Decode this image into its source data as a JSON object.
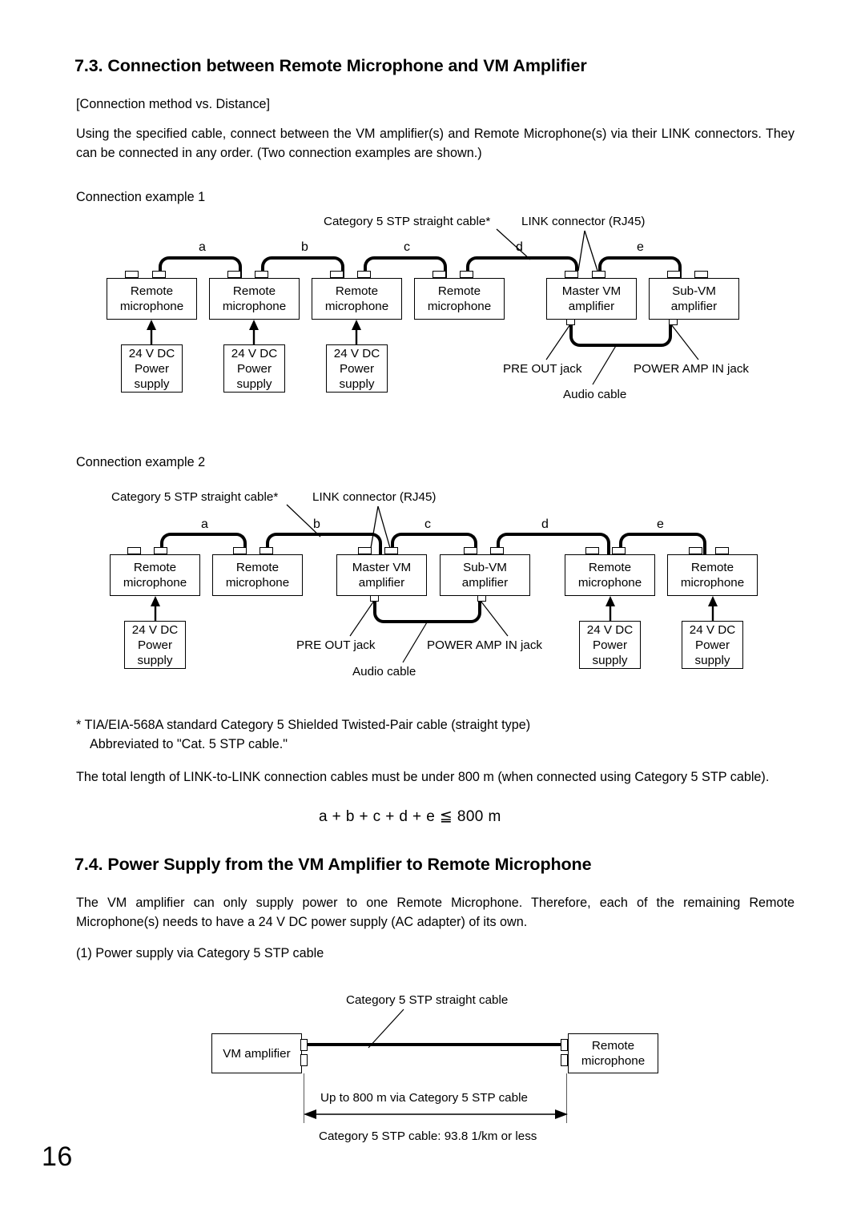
{
  "document": {
    "page_number": "16"
  },
  "section_73": {
    "heading": "7.3. Connection between Remote Microphone and VM Amplifier",
    "subheading": "[Connection method vs. Distance]",
    "intro": "Using the specified cable, connect between the VM amplifier(s) and Remote Microphone(s) via their LINK connectors. They can be connected in any order. (Two connection examples are shown.)",
    "example1_caption": "Connection example 1",
    "example2_caption": "Connection example 2",
    "footnote_line1": "*  TIA/EIA-568A standard Category 5 Shielded Twisted-Pair cable (straight type)",
    "footnote_line2": "Abbreviated to \"Cat. 5 STP cable.\"",
    "total_length_note": "The total length of LINK-to-LINK connection cables must be under 800 m (when connected using Category 5 STP cable).",
    "formula": "a + b + c + d + e  ≦  800 m"
  },
  "diagram1": {
    "labels": {
      "cable_callout": "Category 5 STP straight cable*",
      "link_connector_callout": "LINK connector (RJ45)",
      "pre_out": "PRE OUT jack",
      "power_amp_in": "POWER AMP IN jack",
      "audio_cable": "Audio cable"
    },
    "segments": [
      "a",
      "b",
      "c",
      "d",
      "e"
    ],
    "devices": [
      {
        "line1": "Remote",
        "line2": "microphone"
      },
      {
        "line1": "Remote",
        "line2": "microphone"
      },
      {
        "line1": "Remote",
        "line2": "microphone"
      },
      {
        "line1": "Remote",
        "line2": "microphone"
      },
      {
        "line1": "Master VM",
        "line2": "amplifier"
      },
      {
        "line1": "Sub-VM",
        "line2": "amplifier"
      }
    ],
    "power_supplies": [
      {
        "line1": "24 V DC",
        "line2": "Power",
        "line3": "supply"
      },
      {
        "line1": "24 V DC",
        "line2": "Power",
        "line3": "supply"
      },
      {
        "line1": "24 V DC",
        "line2": "Power",
        "line3": "supply"
      }
    ]
  },
  "diagram2": {
    "labels": {
      "cable_callout": "Category 5 STP straight cable*",
      "link_connector_callout": "LINK connector (RJ45)",
      "pre_out": "PRE OUT jack",
      "power_amp_in": "POWER AMP IN jack",
      "audio_cable": "Audio cable"
    },
    "segments": [
      "a",
      "b",
      "c",
      "d",
      "e"
    ],
    "devices": [
      {
        "line1": "Remote",
        "line2": "microphone"
      },
      {
        "line1": "Remote",
        "line2": "microphone"
      },
      {
        "line1": "Master VM",
        "line2": "amplifier"
      },
      {
        "line1": "Sub-VM",
        "line2": "amplifier"
      },
      {
        "line1": "Remote",
        "line2": "microphone"
      },
      {
        "line1": "Remote",
        "line2": "microphone"
      }
    ],
    "power_supplies": [
      {
        "line1": "24 V DC",
        "line2": "Power",
        "line3": "supply"
      },
      {
        "line1": "24 V DC",
        "line2": "Power",
        "line3": "supply"
      },
      {
        "line1": "24 V DC",
        "line2": "Power",
        "line3": "supply"
      }
    ]
  },
  "section_74": {
    "heading": "7.4. Power Supply from the VM Amplifier to Remote Microphone",
    "body": "The VM amplifier can only supply power to one Remote Microphone. Therefore, each of the remaining Remote Microphone(s) needs to have a 24 V DC power supply (AC adapter) of its own.",
    "item1": "(1) Power supply via Category 5 STP cable"
  },
  "diagram3": {
    "cable_callout": "Category 5 STP straight cable",
    "left_device": "VM amplifier",
    "right_device_line1": "Remote",
    "right_device_line2": "microphone",
    "distance_label": "Up to 800 m via Category 5 STP cable",
    "resistance_note": "Category 5 STP cable: 93.8  1/km or less"
  }
}
